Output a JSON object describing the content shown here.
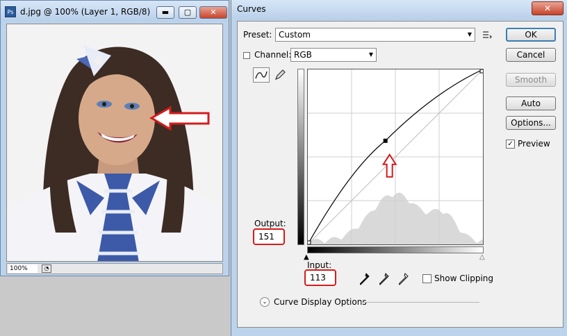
{
  "document_window": {
    "title": "d.jpg @ 100% (Layer 1, RGB/8)",
    "app_icon": "Ps",
    "zoom": "100%",
    "minimize_label": "▬",
    "maximize_label": "▢",
    "close_label": "✕"
  },
  "curves": {
    "window_title": "Curves",
    "close_label": "✕",
    "preset_label": "Preset:",
    "preset_value": "Custom",
    "channel_label": "Channel:",
    "channel_value": "RGB",
    "output_label": "Output:",
    "output_value": "151",
    "input_label": "Input:",
    "input_value": "113",
    "show_clipping_label": "Show Clipping",
    "display_options_label": "Curve Display Options",
    "buttons": {
      "ok": "OK",
      "cancel": "Cancel",
      "smooth": "Smooth",
      "auto": "Auto",
      "options": "Options...",
      "preview": "Preview"
    },
    "preview_checked": true,
    "control_point": {
      "input": 113,
      "output": 151
    },
    "accent_color": "#d41c1c"
  }
}
